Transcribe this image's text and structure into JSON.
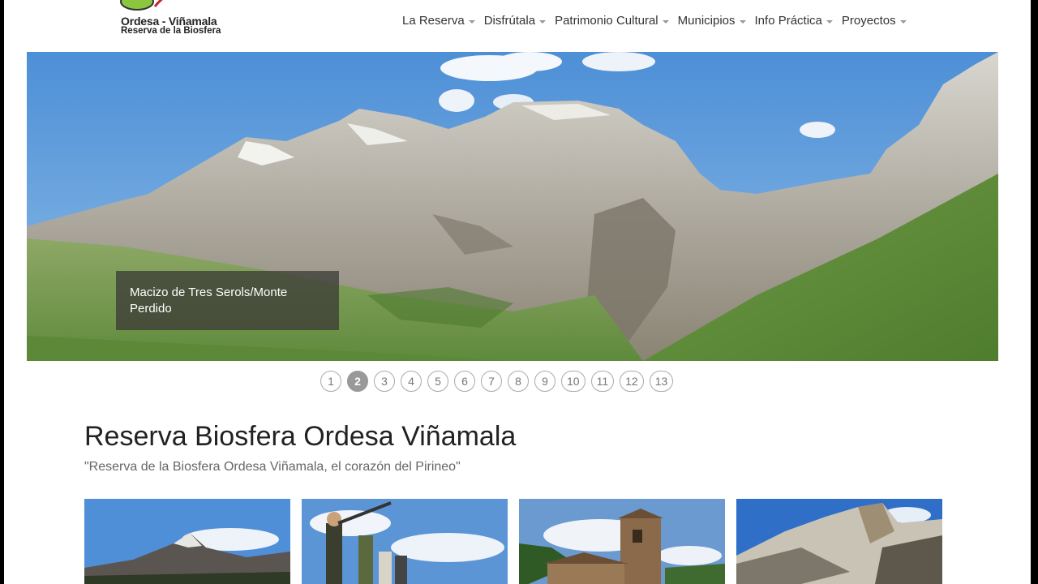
{
  "logo": {
    "title": "Ordesa - Viñamala",
    "subtitle": "Reserva de la Biosfera"
  },
  "nav": {
    "items": [
      {
        "label": "La Reserva"
      },
      {
        "label": "Disfrútala"
      },
      {
        "label": "Patrimonio Cultural"
      },
      {
        "label": "Municipios"
      },
      {
        "label": "Info Práctica"
      },
      {
        "label": "Proyectos"
      }
    ]
  },
  "hero": {
    "caption": "Macizo de Tres Serols/Monte Perdido"
  },
  "pager": {
    "pages": [
      "1",
      "2",
      "3",
      "4",
      "5",
      "6",
      "7",
      "8",
      "9",
      "10",
      "11",
      "12",
      "13"
    ],
    "active": "2"
  },
  "main": {
    "title": "Reserva Biosfera Ordesa Viñamala",
    "subtitle": "\"Reserva de la Biosfera Ordesa Viñamala, el corazón del Pirineo\""
  }
}
